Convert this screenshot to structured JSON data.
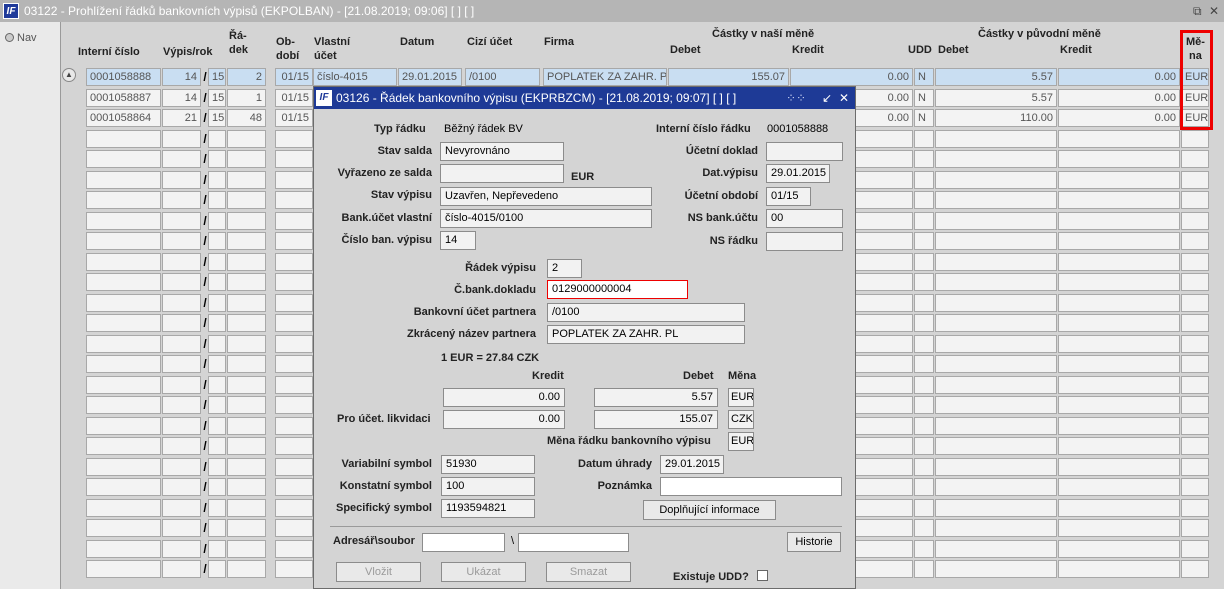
{
  "main_window": {
    "title": "03122 - Prohlížení řádků bankovních výpisů (EKPOLBAN) - [21.08.2019; 09:06]  [ ]  [ ]",
    "logo_text": "IF",
    "controls": [
      "⧉",
      "✕"
    ]
  },
  "nav_button": "Nav",
  "headers": {
    "interni_cislo": "Interní číslo",
    "vypis_rok": "Výpis/rok",
    "radek_1": "Řá-",
    "radek_2": "dek",
    "obdobi_1": "Ob-",
    "obdobi_2": "dobí",
    "vlastni_1": "Vlastní",
    "vlastni_2": "účet",
    "datum": "Datum",
    "cizi_ucet": "Cizí účet",
    "firma": "Firma",
    "castky_nase": "Částky v naší měně",
    "debet_nase": "Debet",
    "kredit_nase": "Kredit",
    "udd": "UDD",
    "castky_puvodni": "Částky v původní měně",
    "debet_puv": "Debet",
    "kredit_puv": "Kredit",
    "mena_1": "Mě-",
    "mena_2": "na"
  },
  "rows": [
    {
      "interni": "0001058888",
      "vypis": "14",
      "rok": "15",
      "radek": "2",
      "obdobi": "01/15",
      "vlastni": "číslo-4015",
      "datum": "29.01.2015",
      "cizi": "/0100",
      "firma": "POPLATEK ZA ZAHR. PL",
      "debet_nase": "155.07",
      "kredit_nase": "0.00",
      "udd": "N",
      "debet_puv": "5.57",
      "kredit_puv": "0.00",
      "mena": "EUR"
    },
    {
      "interni": "0001058887",
      "vypis": "14",
      "rok": "15",
      "radek": "1",
      "obdobi": "01/15",
      "vlastni": "",
      "datum": "",
      "cizi": "",
      "firma": "",
      "debet_nase": "",
      "kredit_nase": "0.00",
      "udd": "N",
      "debet_puv": "5.57",
      "kredit_puv": "0.00",
      "mena": "EUR"
    },
    {
      "interni": "0001058864",
      "vypis": "21",
      "rok": "15",
      "radek": "48",
      "obdobi": "01/15",
      "vlastni": "",
      "datum": "",
      "cizi": "",
      "firma": "",
      "debet_nase": "",
      "kredit_nase": "0.00",
      "udd": "N",
      "debet_puv": "110.00",
      "kredit_puv": "0.00",
      "mena": "EUR"
    }
  ],
  "empty_row_slash": "/",
  "dialog": {
    "title": "03126 - Řádek bankovního výpisu (EKPRBZCM) - [21.08.2019; 09:07]  [ ]  [ ]",
    "logo_text": "IF",
    "controls": [
      "⁘⁘",
      "↙",
      "✕"
    ],
    "typ_radku_label": "Typ řádku",
    "typ_radku_value": "Běžný řádek BV",
    "interni_cislo_label": "Interní číslo řádku",
    "interni_cislo_value": "0001058888",
    "stav_salda_label": "Stav salda",
    "stav_salda_value": "Nevyrovnáno",
    "ucetni_doklad_label": "Účetní doklad",
    "ucetni_doklad_value": "",
    "vyrazeno_label": "Vyřazeno ze salda",
    "vyrazeno_value": "",
    "vyrazeno_currency": "EUR",
    "dat_vypisu_label": "Dat.výpisu",
    "dat_vypisu_value": "29.01.2015",
    "stav_vypisu_label": "Stav výpisu",
    "stav_vypisu_value": "Uzavřen, Nepřevedeno",
    "ucetni_obdobi_label": "Účetní období",
    "ucetni_obdobi_value": "01/15",
    "bank_ucet_label": "Bank.účet vlastní",
    "bank_ucet_value": "číslo-4015/0100",
    "ns_bank_label": "NS bank.účtu",
    "ns_bank_value": "00",
    "cislo_vypisu_label": "Číslo ban. výpisu",
    "cislo_vypisu_value": "14",
    "ns_radku_label": "NS řádku",
    "ns_radku_value": "",
    "radek_vypisu_label": "Řádek výpisu",
    "radek_vypisu_value": "2",
    "c_bank_dokladu_label": "Č.bank.dokladu",
    "c_bank_dokladu_value": "0129000000004",
    "bank_ucet_partnera_label": "Bankovní účet partnera",
    "bank_ucet_partnera_value": "/0100",
    "zkraceny_nazev_label": "Zkrácený název partnera",
    "zkraceny_nazev_value": "POPLATEK ZA ZAHR. PL",
    "kurz_text": "1 EUR = 27.84 CZK",
    "kredit_hdr": "Kredit",
    "debet_hdr": "Debet",
    "mena_hdr": "Měna",
    "row1_kredit": "0.00",
    "row1_debet": "5.57",
    "row1_mena": "EUR",
    "pro_ucet_label": "Pro účet. likvidaci",
    "row2_kredit": "0.00",
    "row2_debet": "155.07",
    "row2_mena": "CZK",
    "mena_radku_label": "Měna řádku bankovního výpisu",
    "mena_radku_value": "EUR",
    "var_symbol_label": "Variabilní symbol",
    "var_symbol_value": "51930",
    "datum_uhrady_label": "Datum úhrady",
    "datum_uhrady_value": "29.01.2015",
    "konst_symbol_label": "Konstatní symbol",
    "konst_symbol_value": "100",
    "poznamka_label": "Poznámka",
    "poznamka_value": "",
    "spec_symbol_label": "Specifický symbol",
    "spec_symbol_value": "1193594821",
    "doplnujici_button": "Doplňující informace",
    "adresar_label": "Adresář\\soubor",
    "adresar_sep": "\\",
    "adresar_value": "",
    "soubor_value": "",
    "historie_button": "Historie",
    "vlozit_button": "Vložit",
    "ukazat_button": "Ukázat",
    "smazat_button": "Smazat",
    "existuje_udd_label": "Existuje UDD?"
  }
}
